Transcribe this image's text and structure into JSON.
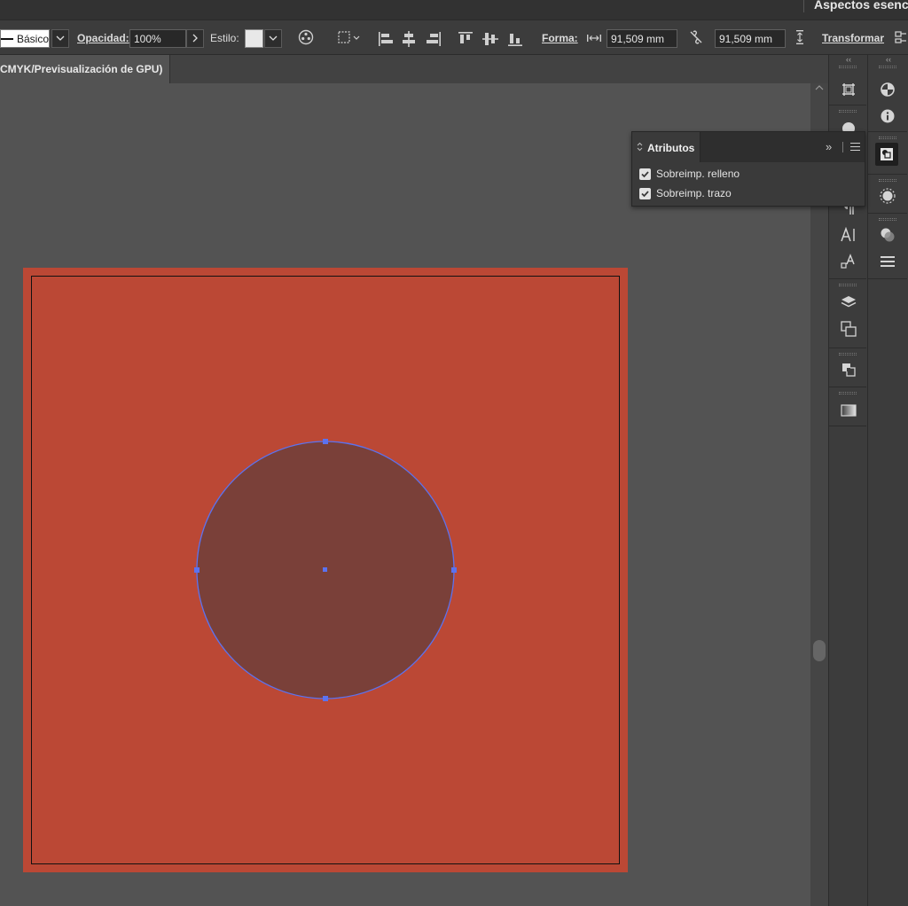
{
  "workspace": {
    "label": "Aspectos esenc"
  },
  "control_bar": {
    "stroke_profile": "Básico",
    "opacity_label": "Opacidad:",
    "opacity_value": "100%",
    "style_label": "Estilo:",
    "shape_label": "Forma:",
    "width_value": "91,509 mm",
    "height_value": "91,509 mm",
    "transform_label": "Transformar"
  },
  "document": {
    "tab_title": "CMYK/Previsualización de GPU)"
  },
  "canvas": {
    "artboard_color": "#bb4835",
    "circle_fill": "#7a4039",
    "selection_color": "#5b72f0"
  },
  "attributes_panel": {
    "title": "Atributos",
    "expand_glyph": "»",
    "options": [
      {
        "label": "Sobreimp. relleno",
        "checked": true
      },
      {
        "label": "Sobreimp. trazo",
        "checked": true
      }
    ]
  },
  "docks": {
    "collapse_glyph": "‹‹",
    "dock1_icons": [
      "artboards-icon",
      "color-guide-icon",
      "paragraph-icon",
      "character-icon",
      "character-styles-icon",
      "layers-icon",
      "links-icon",
      "pathfinder-icon",
      "gradient-icon"
    ],
    "dock2_icons": [
      "color-icon",
      "info-icon",
      "attributes-icon",
      "brushes-icon",
      "transparency-icon",
      "stroke-icon"
    ]
  }
}
